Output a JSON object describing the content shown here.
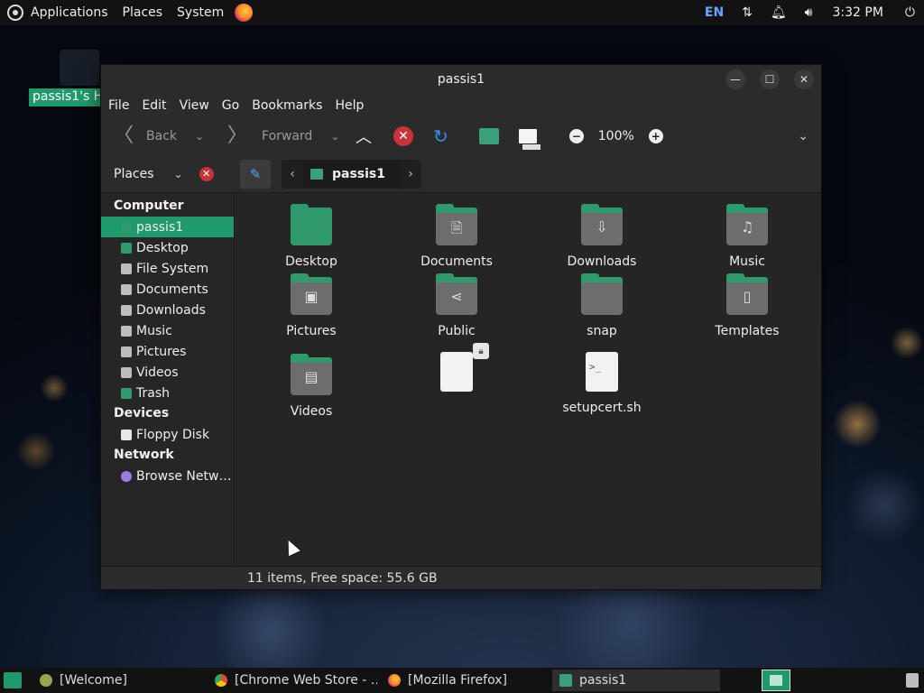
{
  "top_panel": {
    "applications": "Applications",
    "places": "Places",
    "system": "System",
    "lang": "EN",
    "clock": "3:32 PM"
  },
  "desktop": {
    "label": "passis1's H"
  },
  "window": {
    "title": "passis1",
    "menu": [
      "File",
      "Edit",
      "View",
      "Go",
      "Bookmarks",
      "Help"
    ],
    "toolbar": {
      "back": "Back",
      "forward": "Forward",
      "zoom": "100%"
    },
    "places_label": "Places",
    "breadcrumb": "passis1",
    "sidebar": {
      "sections": [
        {
          "title": "Computer",
          "items": [
            "passis1",
            "Desktop",
            "File System",
            "Documents",
            "Downloads",
            "Music",
            "Pictures",
            "Videos",
            "Trash"
          ]
        },
        {
          "title": "Devices",
          "items": [
            "Floppy Disk"
          ]
        },
        {
          "title": "Network",
          "items": [
            "Browse Netw…"
          ]
        }
      ]
    },
    "files": [
      {
        "name": "Desktop",
        "kind": "folder-full"
      },
      {
        "name": "Documents",
        "kind": "folder",
        "glyph": "🗎"
      },
      {
        "name": "Downloads",
        "kind": "folder",
        "glyph": "⇩"
      },
      {
        "name": "Music",
        "kind": "folder",
        "glyph": "♫"
      },
      {
        "name": "Pictures",
        "kind": "folder",
        "glyph": "▣"
      },
      {
        "name": "Public",
        "kind": "folder",
        "glyph": "⋖"
      },
      {
        "name": "snap",
        "kind": "folder",
        "glyph": ""
      },
      {
        "name": "Templates",
        "kind": "folder",
        "glyph": "▯"
      },
      {
        "name": "Videos",
        "kind": "folder",
        "glyph": "▤"
      },
      {
        "name": "",
        "kind": "doc-locked"
      },
      {
        "name": "setupcert.sh",
        "kind": "script"
      }
    ],
    "status": "11 items, Free space: 55.6 GB"
  },
  "taskbar": {
    "tasks": [
      "[Welcome]",
      "[Chrome Web Store - …",
      "[Mozilla Firefox]",
      "passis1"
    ]
  },
  "colors": {
    "accent": "#1f9a6a",
    "folder_tab": "#2e9a6e",
    "folder_body": "#6d6d6d"
  }
}
